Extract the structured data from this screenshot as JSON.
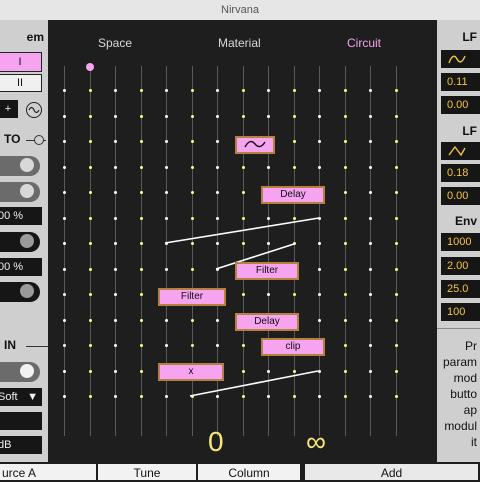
{
  "window": {
    "title": "Nirvana"
  },
  "left_panel": {
    "section1": {
      "title": "em",
      "btn1": "I",
      "btn2": "II",
      "btn3": "+"
    },
    "section2": {
      "title": "TO",
      "value1": "00 %",
      "value2": "00 %"
    },
    "section3": {
      "title": "IN",
      "mode": "Soft",
      "level": "dB"
    }
  },
  "tabs": [
    {
      "label": "Space",
      "active": false
    },
    {
      "label": "Material",
      "active": false
    },
    {
      "label": "Circuit",
      "active": true
    }
  ],
  "nodes": {
    "lfo": "",
    "delay1": "Delay",
    "filter1": "Filter",
    "filter2": "Filter",
    "delay2": "Delay",
    "clip": "clip",
    "mult": "x"
  },
  "footer_glyphs": {
    "zero": "0",
    "infinity": "∞"
  },
  "right_panel": {
    "lfo1": {
      "title": "LF",
      "rate": "0.11",
      "amount": "0.00"
    },
    "lfo2": {
      "title": "LF",
      "rate": "0.18",
      "amount": "0.00"
    },
    "env": {
      "title": "Env",
      "attack": "1000",
      "decay": "2.00",
      "sustain": "25.0",
      "release": "100"
    },
    "info_lines": [
      "Pr",
      "param",
      "mod",
      "butto",
      "ap",
      "modul",
      "it"
    ]
  },
  "bottom_bar": {
    "col1": "urce A",
    "col2": "Tune",
    "col3": "Column",
    "add": "Add"
  },
  "colors": {
    "accent_pink": "#f6a3f0",
    "yellow": "#f5c542",
    "dot_white": "#ffffff",
    "dot_yellow": "#ffff88"
  }
}
